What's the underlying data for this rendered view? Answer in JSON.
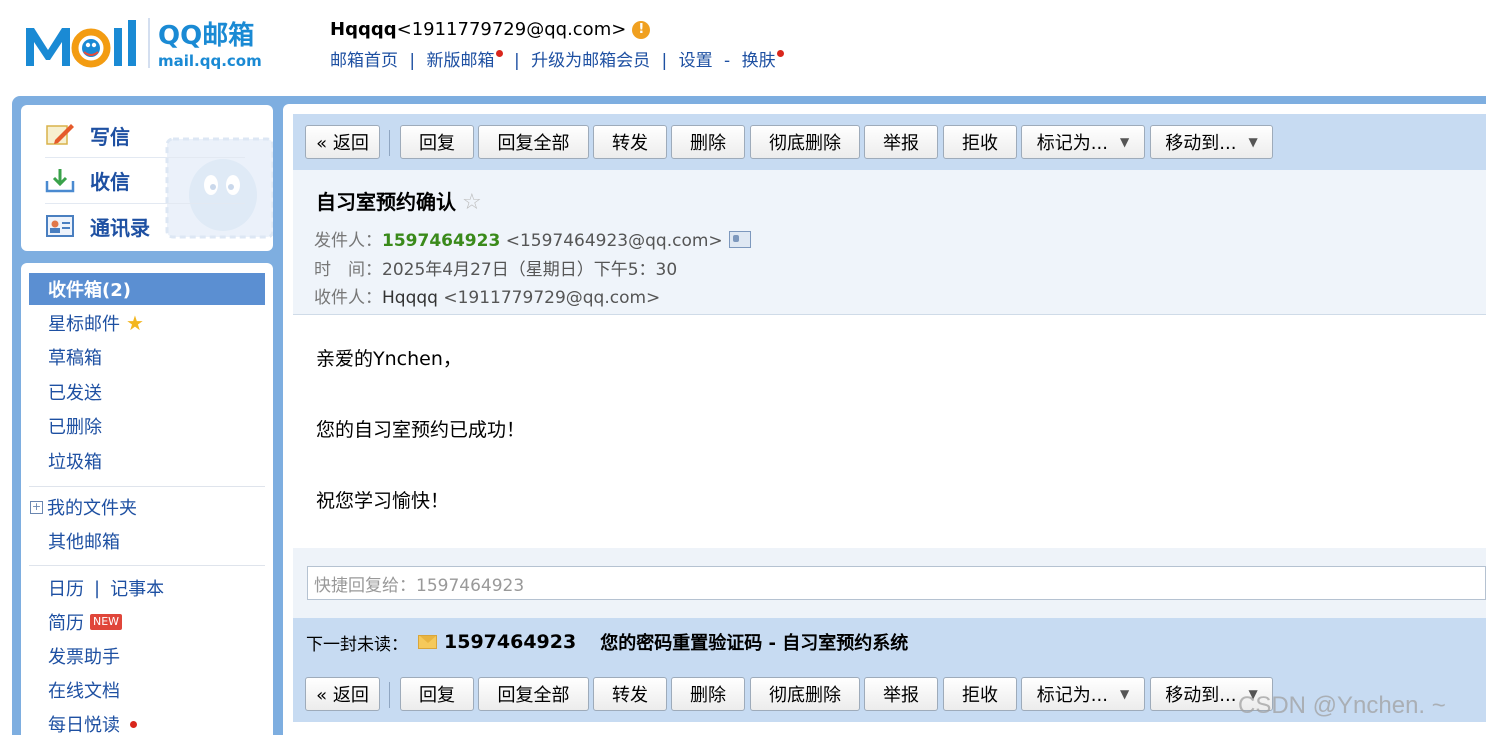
{
  "header": {
    "logo_text": "QQ邮箱",
    "logo_sub": "mail.qq.com",
    "logo_mail": "M  il",
    "user_name": "Hqqqq",
    "user_email": "<1911779729@qq.com>",
    "warning": "!",
    "links": [
      "邮箱首页",
      "新版邮箱",
      "升级为邮箱会员",
      "设置",
      "换肤"
    ],
    "sep": "|",
    "dash": "-"
  },
  "sidebar": {
    "quick": [
      "写信",
      "收信",
      "通讯录"
    ],
    "folders": [
      "收件箱(2)",
      "星标邮件",
      "草稿箱",
      "已发送",
      "已删除",
      "垃圾箱"
    ],
    "my_folders": "我的文件夹",
    "plus": "+",
    "other_mail": "其他邮箱",
    "calendar": "日历",
    "notes": "记事本",
    "resume": "简历",
    "new_badge": "NEW",
    "invoice": "发票助手",
    "docs": "在线文档",
    "daily": "每日悦读",
    "star_glyph": "★"
  },
  "toolbar": {
    "back": "« 返回",
    "reply": "回复",
    "reply_all": "回复全部",
    "forward": "转发",
    "delete": "删除",
    "delete_perm": "彻底删除",
    "report": "举报",
    "reject": "拒收",
    "mark_as": "标记为...",
    "move_to": "移动到...",
    "caret": "▼"
  },
  "mail": {
    "subject": "自习室预约确认",
    "star": "☆",
    "from_label": "发件人：",
    "from_name": "1597464923",
    "from_addr": "<1597464923@qq.com>",
    "time_label": "时　间：",
    "time_value": "2025年4月27日（星期日）下午5：30",
    "to_label": "收件人：",
    "to_name": "Hqqqq",
    "to_addr": "<1911779729@qq.com>",
    "body": [
      "亲爱的Ynchen，",
      "您的自习室预约已成功！",
      "祝您学习愉快！"
    ]
  },
  "quick_reply": {
    "placeholder": "快捷回复给：1597464923"
  },
  "next_unread": {
    "label": "下一封未读：",
    "from": "1597464923",
    "subject": "您的密码重置验证码 - 自习室预约系统"
  },
  "watermark": "CSDN @Ynchen. ~",
  "colors": {
    "frame_blue": "#7eaee0",
    "toolbar_blue": "#c7dbf2",
    "active_folder": "#5b8fd2",
    "link_blue": "#1e50a2",
    "sender_green": "#3a8a1a"
  }
}
